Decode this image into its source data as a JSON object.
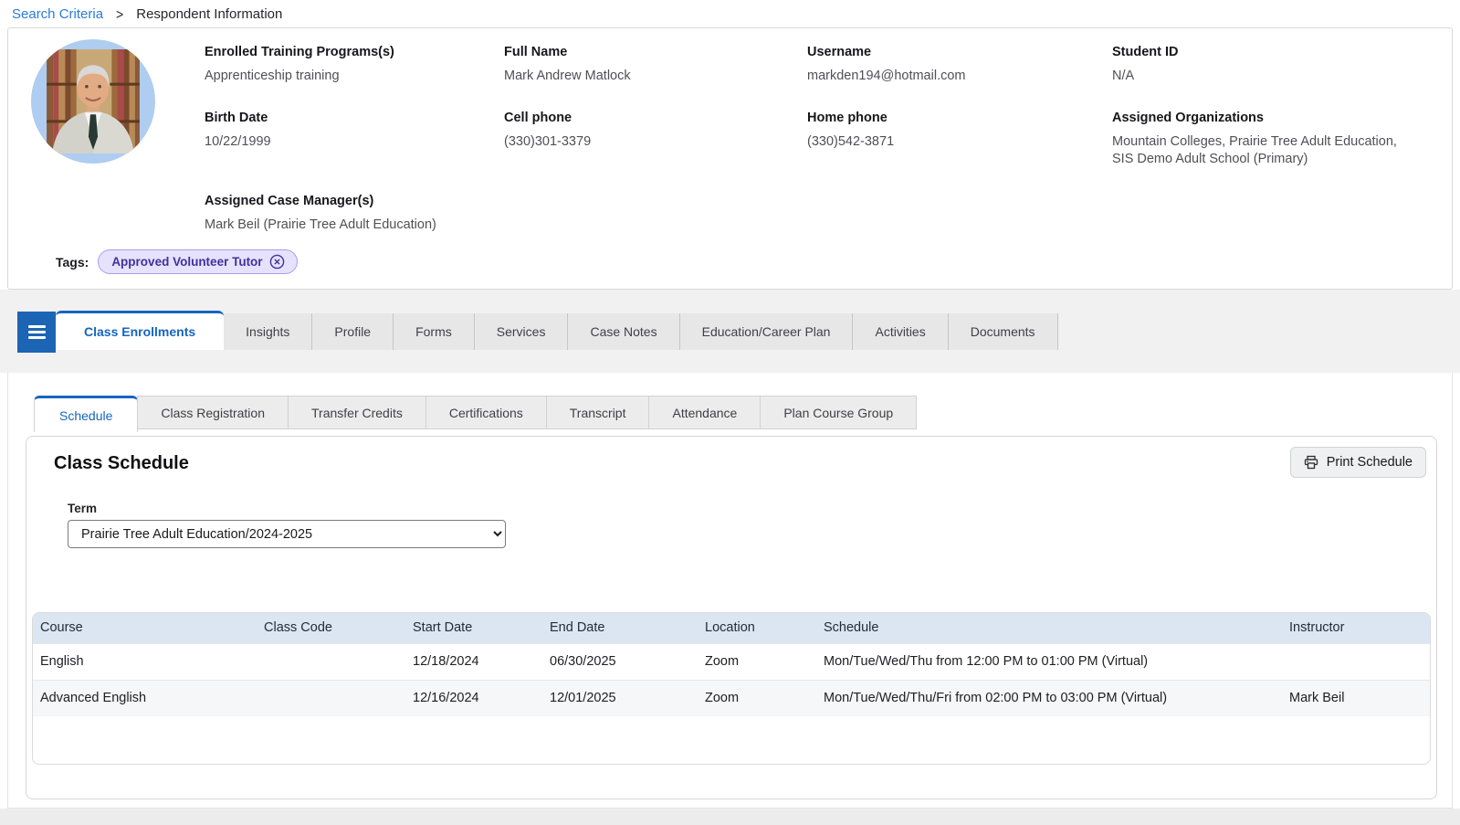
{
  "breadcrumb": {
    "link": "Search Criteria",
    "separator": ">",
    "current": "Respondent Information"
  },
  "profile": {
    "enrolled_programs": {
      "label": "Enrolled Training Programs(s)",
      "value": "Apprenticeship training"
    },
    "full_name": {
      "label": "Full Name",
      "value": "Mark Andrew Matlock"
    },
    "username": {
      "label": "Username",
      "value": "markden194@hotmail.com"
    },
    "student_id": {
      "label": "Student ID",
      "value": "N/A"
    },
    "birth_date": {
      "label": "Birth Date",
      "value": "10/22/1999"
    },
    "cell_phone": {
      "label": "Cell phone",
      "value": "(330)301-3379"
    },
    "home_phone": {
      "label": "Home phone",
      "value": "(330)542-3871"
    },
    "assigned_orgs": {
      "label": "Assigned Organizations",
      "value": "Mountain Colleges, Prairie Tree Adult Education, SIS Demo Adult School (Primary)"
    },
    "case_managers": {
      "label": "Assigned Case Manager(s)",
      "value": "Mark Beil (Prairie Tree Adult Education)"
    },
    "tags_label": "Tags:",
    "tags": [
      {
        "label": "Approved Volunteer Tutor"
      }
    ]
  },
  "main_tabs": {
    "active": "Class Enrollments",
    "items": [
      "Class Enrollments",
      "Insights",
      "Profile",
      "Forms",
      "Services",
      "Case Notes",
      "Education/Career Plan",
      "Activities",
      "Documents"
    ]
  },
  "sub_tabs": {
    "active": "Schedule",
    "items": [
      "Schedule",
      "Class Registration",
      "Transfer Credits",
      "Certifications",
      "Transcript",
      "Attendance",
      "Plan Course Group"
    ]
  },
  "schedule_panel": {
    "title": "Class Schedule",
    "print_button": "Print Schedule",
    "term_label": "Term",
    "term_value": "Prairie Tree Adult Education/2024-2025",
    "table": {
      "columns": [
        "Course",
        "Class Code",
        "Start Date",
        "End Date",
        "Location",
        "Schedule",
        "Instructor"
      ],
      "rows": [
        [
          "English",
          "",
          "12/18/2024",
          "06/30/2025",
          "Zoom",
          "Mon/Tue/Wed/Thu from 12:00 PM to 01:00 PM (Virtual)",
          ""
        ],
        [
          "Advanced English",
          "",
          "12/16/2024",
          "12/01/2025",
          "Zoom",
          "Mon/Tue/Wed/Thu/Fri from 02:00 PM to 03:00 PM (Virtual)",
          "Mark Beil"
        ]
      ]
    }
  },
  "colors": {
    "accent_blue": "#1565c0",
    "link_blue": "#2b7bd9",
    "tag_purple_bg": "#e7e2fb",
    "tag_purple_border": "#a79cf0",
    "tag_purple_text": "#41309f",
    "table_header_bg": "#dce6f2"
  }
}
